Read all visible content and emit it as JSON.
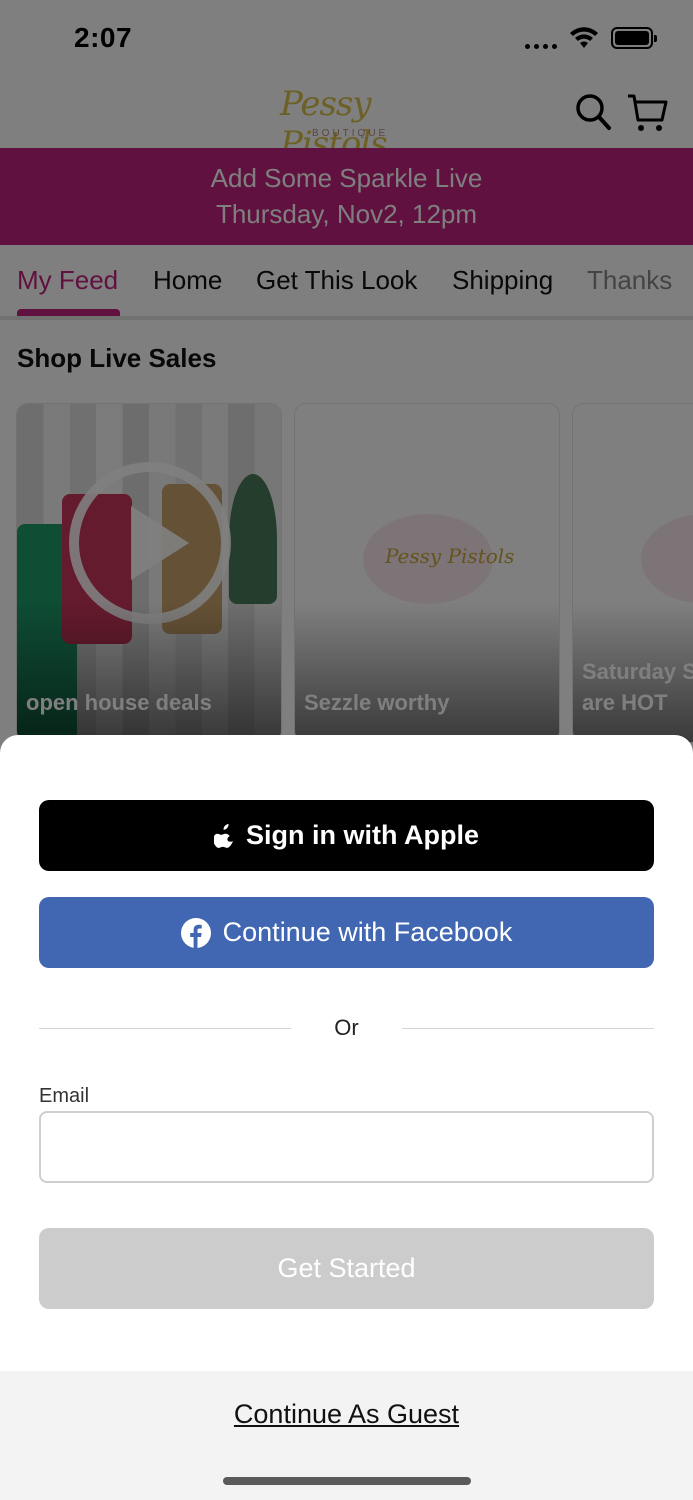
{
  "status_bar": {
    "time": "2:07",
    "icons": [
      "signal-dots-icon",
      "wifi-icon",
      "battery-icon"
    ]
  },
  "nav": {
    "logo_text": "Pessy Pistols",
    "logo_sub": "BOUTIQUE",
    "icons": [
      "search-icon",
      "cart-icon"
    ]
  },
  "promo": {
    "line1": "Add Some Sparkle Live",
    "line2": "Thursday, Nov2, 12pm"
  },
  "tabs": [
    {
      "label": "My Feed",
      "active": true
    },
    {
      "label": "Home"
    },
    {
      "label": "Get This Look"
    },
    {
      "label": "Shipping"
    },
    {
      "label": "Thanks"
    }
  ],
  "section_title": "Shop Live Sales",
  "cards": [
    {
      "title": "open house deals"
    },
    {
      "title": "Sezzle worthy"
    },
    {
      "title_line1": "Saturday S",
      "title_line2": "are HOT"
    }
  ],
  "sheet": {
    "apple_label": "Sign in with Apple",
    "facebook_label": "Continue with Facebook",
    "or_text": "Or",
    "email_label": "Email",
    "email_value": "",
    "email_placeholder": "",
    "get_started_label": "Get Started",
    "guest_label": "Continue As Guest"
  },
  "colors": {
    "brand": "#c0227e",
    "facebook": "#4267b2",
    "apple": "#000000",
    "disabled": "#cccccc"
  }
}
